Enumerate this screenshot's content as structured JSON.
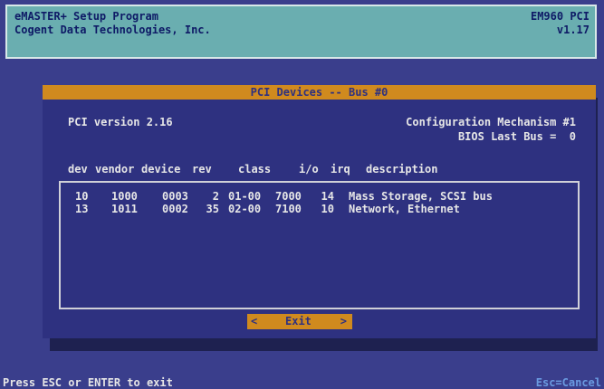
{
  "header": {
    "program_title": "eMASTER+ Setup Program",
    "company": "Cogent Data Technologies, Inc.",
    "product": "EM960 PCI",
    "version": "v1.17"
  },
  "dialog": {
    "title": "PCI Devices -- Bus #0",
    "pci_version": "PCI version 2.16",
    "config_mechanism": "Configuration Mechanism #1",
    "bios_last_bus": "BIOS Last Bus =  0",
    "columns": [
      "dev",
      "vendor",
      "device",
      "rev",
      "class",
      "i/o",
      "irq",
      "description"
    ],
    "rows": [
      {
        "dev": "10",
        "vendor": "1000",
        "device": "0003",
        "rev": "2",
        "class": "01-00",
        "io": "7000",
        "irq": "14",
        "description": "Mass Storage, SCSI bus"
      },
      {
        "dev": "13",
        "vendor": "1011",
        "device": "0002",
        "rev": "35",
        "class": "02-00",
        "io": "7100",
        "irq": "10",
        "description": "Network, Ethernet"
      }
    ],
    "exit_button": {
      "left_arrow": "<",
      "label": "Exit",
      "right_arrow": ">"
    }
  },
  "status_bar": {
    "hint": "Press ESC or ENTER to exit",
    "shortcut": "Esc=Cancel"
  },
  "colors": {
    "background": "#3a3e8c",
    "header": "#6aaeb0",
    "accent": "#d08a1e",
    "text": "#e6e6e6",
    "status_shortcut": "#6a9ae0"
  }
}
